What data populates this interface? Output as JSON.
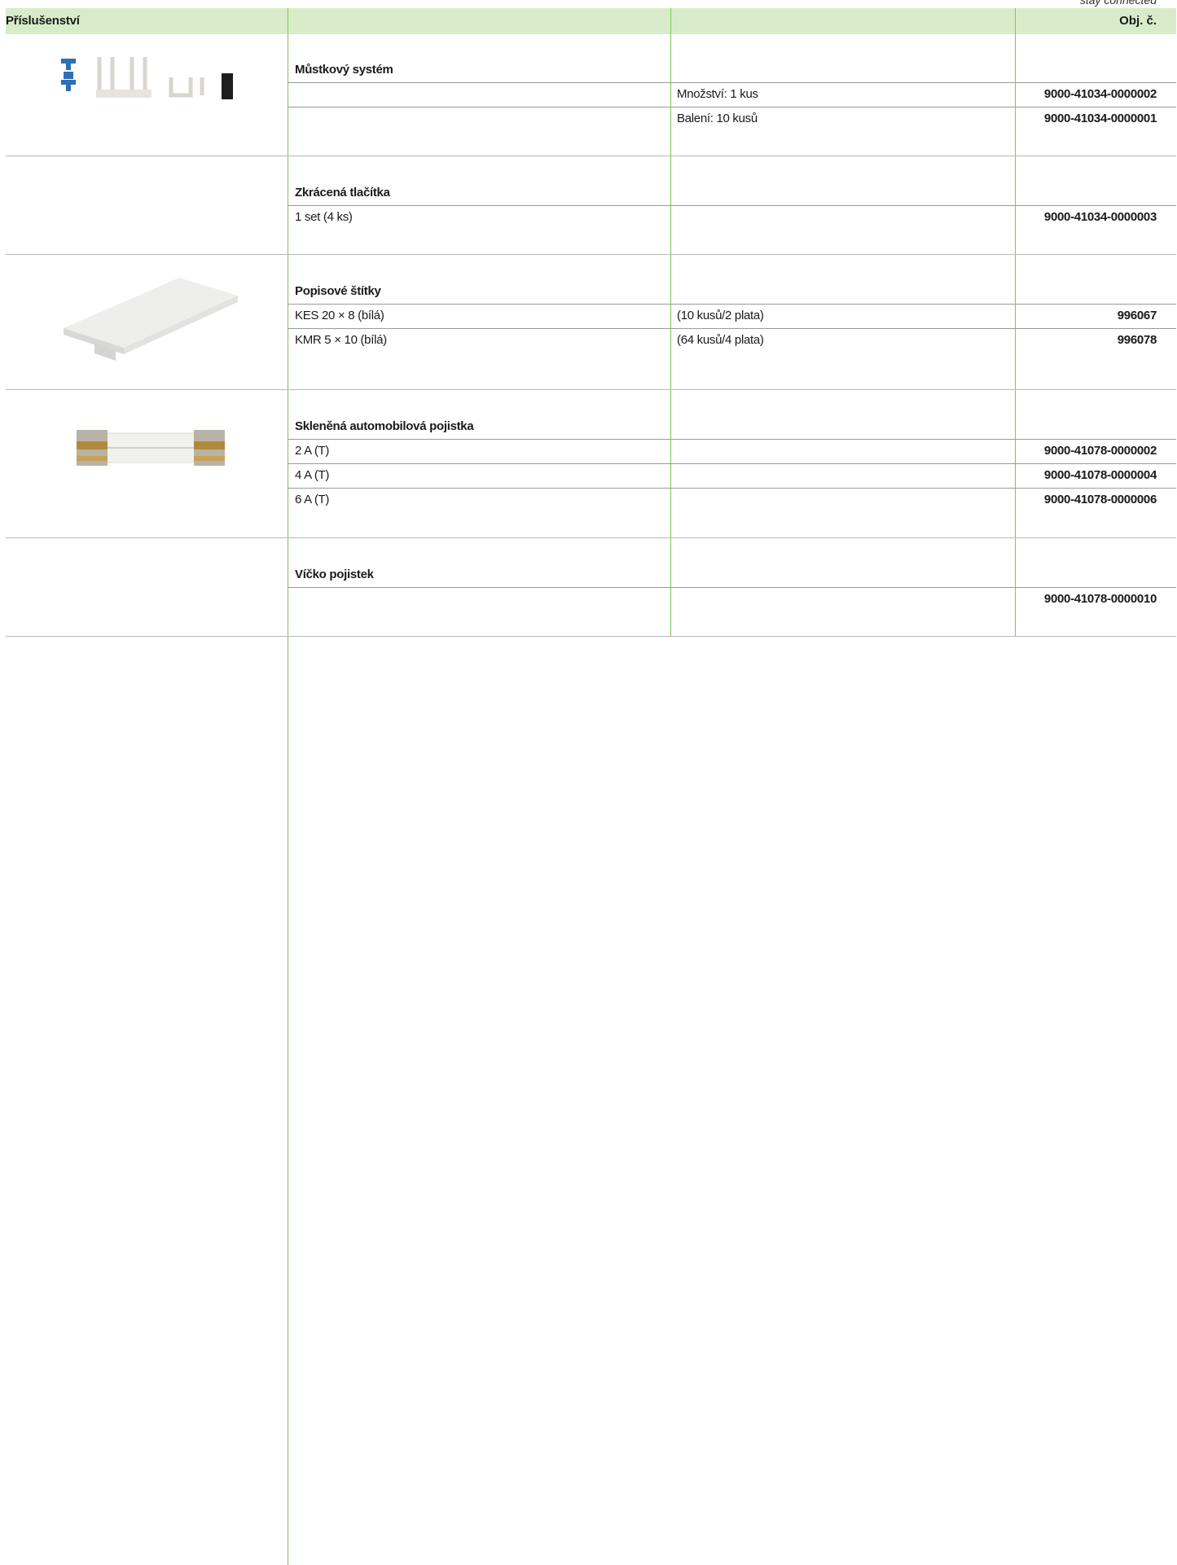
{
  "tagline": "stay connected",
  "header": {
    "left": "Příslušenství",
    "right": "Obj. č."
  },
  "sections": [
    {
      "title": "Můstkový systém",
      "rows": [
        {
          "desc": "",
          "pack": "Množství: 1 kus",
          "code": "9000-41034-0000002"
        },
        {
          "desc": "",
          "pack": "Balení: 10 kusů",
          "code": "9000-41034-0000001"
        }
      ]
    },
    {
      "title": "Zkrácená tlačítka",
      "rows": [
        {
          "desc": "1 set (4 ks)",
          "pack": "",
          "code": "9000-41034-0000003"
        }
      ]
    },
    {
      "title": "Popisové štítky",
      "rows": [
        {
          "desc": "KES 20 × 8 (bílá)",
          "pack": "(10 kusů/2 plata)",
          "code": "996067"
        },
        {
          "desc": "KMR 5 × 10 (bílá)",
          "pack": "(64 kusů/4 plata)",
          "code": "996078"
        }
      ]
    },
    {
      "title": "Skleněná automobilová pojistka",
      "rows": [
        {
          "desc": "2 A (T)",
          "pack": "",
          "code": "9000-41078-0000002"
        },
        {
          "desc": "4 A (T)",
          "pack": "",
          "code": "9000-41078-0000004"
        },
        {
          "desc": "6 A (T)",
          "pack": "",
          "code": "9000-41078-0000006"
        }
      ]
    },
    {
      "title": "Víčko pojistek",
      "rows": [
        {
          "desc": "",
          "pack": "",
          "code": "9000-41078-0000010"
        }
      ]
    }
  ]
}
